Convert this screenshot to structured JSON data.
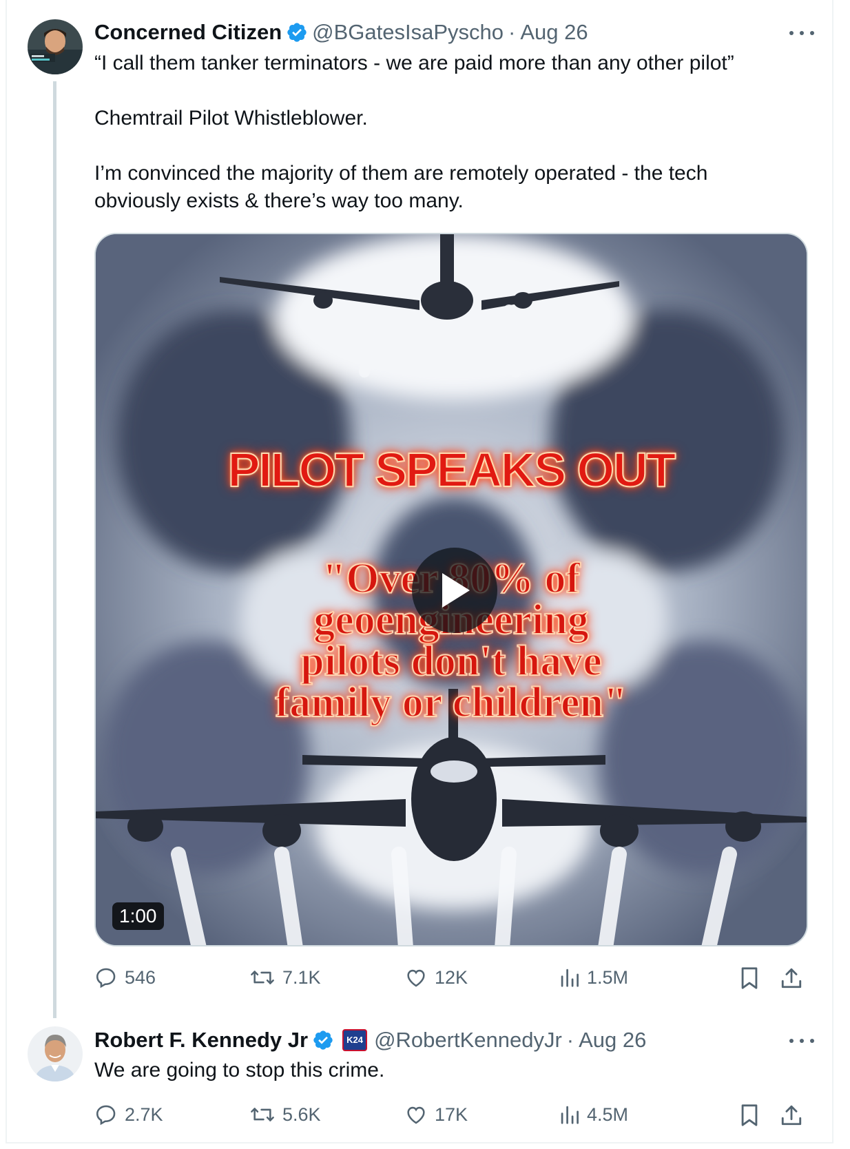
{
  "tweets": [
    {
      "author": "Concerned Citizen",
      "handle": "@BGatesIsaPyscho",
      "separator": "·",
      "date": "Aug 26",
      "paragraphs": [
        "“I call them tanker terminators - we are paid more than any other pilot”",
        "Chemtrail Pilot Whistleblower.",
        "I’m convinced the majority of them are remotely operated - the tech obviously exists & there’s way too many."
      ],
      "media": {
        "headline": "PILOT SPEAKS OUT",
        "quote_lines": [
          "\"Over 80% of",
          "geoengineering",
          "pilots don't have",
          "family or children\""
        ],
        "duration": "1:00"
      },
      "stats": {
        "replies": "546",
        "reposts": "7.1K",
        "likes": "12K",
        "views": "1.5M"
      }
    },
    {
      "author": "Robert F. Kennedy Jr",
      "badge": "K24",
      "handle": "@RobertKennedyJr",
      "separator": "·",
      "date": "Aug 26",
      "text": "We are going to stop this crime.",
      "stats": {
        "replies": "2.7K",
        "reposts": "5.6K",
        "likes": "17K",
        "views": "4.5M"
      }
    }
  ],
  "icons": {
    "verified": "verified-badge-icon",
    "more": "more-icon",
    "reply": "reply-icon",
    "repost": "repost-icon",
    "like": "like-icon",
    "views": "views-icon",
    "bookmark": "bookmark-icon",
    "share": "share-icon",
    "play": "play-icon"
  },
  "colors": {
    "text": "#0f1419",
    "secondary": "#536471",
    "verified": "#1d9bf0",
    "border": "#cfd9de",
    "headline": "#e11a12"
  }
}
